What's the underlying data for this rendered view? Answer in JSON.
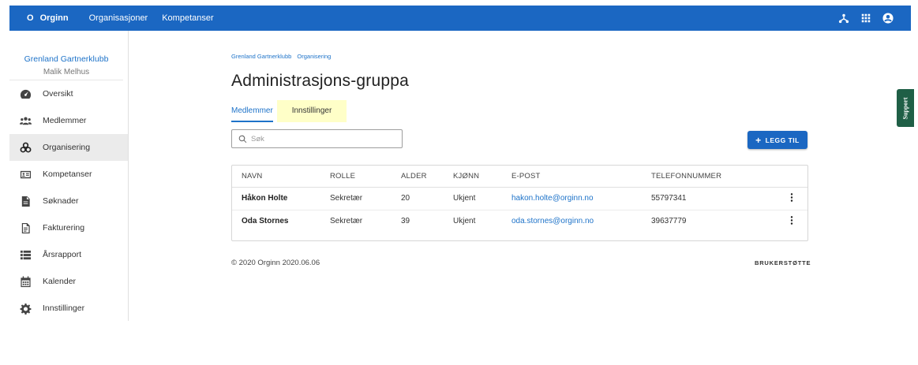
{
  "topbar": {
    "brand_mark": "O",
    "brand_name": "Orginn",
    "nav": [
      "Organisasjoner",
      "Kompetanser"
    ],
    "icons": [
      "network-icon",
      "apps-grid-icon",
      "account-circle-icon"
    ]
  },
  "sidebar": {
    "org_name": "Grenland Gartnerklubb",
    "user_name": "Malik Melhus",
    "items": [
      {
        "label": "Oversikt",
        "icon": "dashboard-icon"
      },
      {
        "label": "Medlemmer",
        "icon": "group-icon"
      },
      {
        "label": "Organisering",
        "icon": "organization-icon",
        "active": true
      },
      {
        "label": "Kompetanser",
        "icon": "id-card-icon"
      },
      {
        "label": "Søknader",
        "icon": "document-icon"
      },
      {
        "label": "Fakturering",
        "icon": "invoice-icon"
      },
      {
        "label": "Årsrapport",
        "icon": "list-icon"
      },
      {
        "label": "Kalender",
        "icon": "calendar-icon"
      },
      {
        "label": "Innstillinger",
        "icon": "gear-icon"
      }
    ]
  },
  "main": {
    "breadcrumb": [
      "Grenland Gartnerklubb",
      "Organisering"
    ],
    "title": "Administrasjons-gruppa",
    "tabs": [
      {
        "label": "Medlemmer",
        "active": true
      },
      {
        "label": "Innstillinger",
        "active": false
      }
    ],
    "search": {
      "placeholder": "Søk",
      "value": ""
    },
    "add_button": "LEGG TIL",
    "table": {
      "columns": [
        "NAVN",
        "ROLLE",
        "ALDER",
        "KJØNN",
        "E-POST",
        "TELEFONNUMMER"
      ],
      "rows": [
        {
          "name": "Håkon Holte",
          "role": "Sekretær",
          "age": "20",
          "gender": "Ukjent",
          "email": "hakon.holte@orginn.no",
          "phone": "55797341"
        },
        {
          "name": "Oda Stornes",
          "role": "Sekretær",
          "age": "39",
          "gender": "Ukjent",
          "email": "oda.stornes@orginn.no",
          "phone": "39637779"
        }
      ]
    },
    "footer_left": "© 2020 Orginn 2020.06.06",
    "footer_right": "BRUKERSTØTTE"
  },
  "support_tab": "Support",
  "colors": {
    "primary": "#1b67c2",
    "link": "#1e73c9",
    "support": "#1f5f46",
    "tab_highlight": "#ffffc8"
  }
}
